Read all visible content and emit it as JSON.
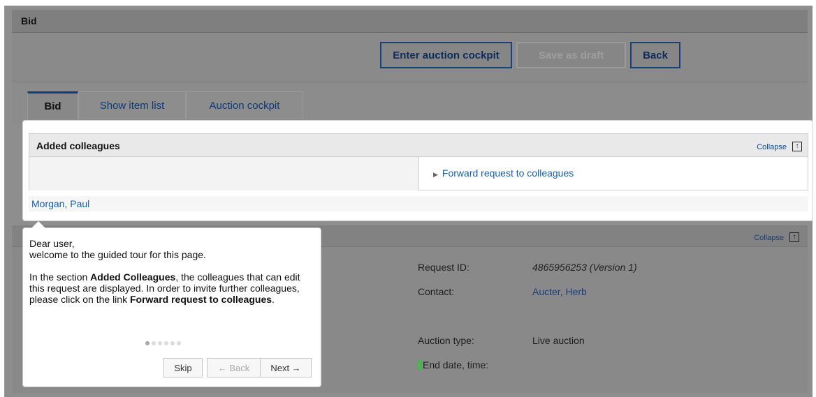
{
  "header": {
    "title": "Bid"
  },
  "toolbar": {
    "enter_cockpit": "Enter auction cockpit",
    "save_draft": "Save as draft",
    "back": "Back"
  },
  "tabs": [
    {
      "label": "Bid"
    },
    {
      "label": "Show item list"
    },
    {
      "label": "Auction cockpit"
    }
  ],
  "added_colleagues": {
    "title": "Added colleagues",
    "collapse_label": "Collapse",
    "forward_link": "Forward request to colleagues",
    "colleagues": [
      "Morgan, Paul"
    ]
  },
  "details": {
    "collapse_label": "Collapse",
    "request_id_label": "Request ID:",
    "request_id_value": "4865956253 (Version 1)",
    "contact_label": "Contact:",
    "contact_value": "Aucter, Herb",
    "auction_type_label": "Auction type:",
    "auction_type_value": "Live auction",
    "end_date_label": "End date, time:"
  },
  "tour": {
    "greeting": "Dear user,",
    "welcome": "welcome to the guided tour for this page.",
    "p2_a": "In the section ",
    "p2_b": "Added Colleagues",
    "p2_c": ", the colleagues that can edit this request are displayed. In order to invite further colleagues, please click on the link ",
    "p2_d": "Forward request to colleagues",
    "p2_e": ".",
    "steps_total": 6,
    "step_current": 1,
    "skip": "Skip",
    "back": "← Back",
    "next": "Next →"
  },
  "colors": {
    "link": "#1460b0",
    "dark_blue": "#1d3f78",
    "marker_green": "#3fbf3f"
  }
}
